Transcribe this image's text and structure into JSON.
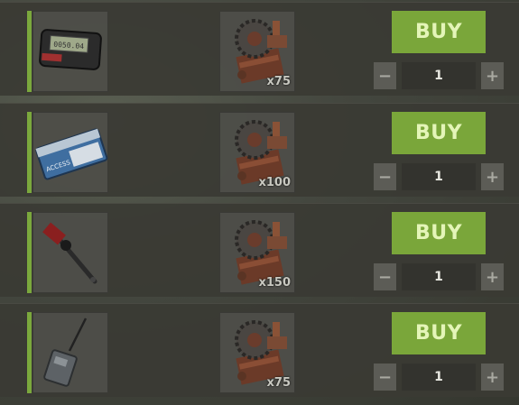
{
  "shop": {
    "offers": [
      {
        "item_icon": "pager-icon",
        "cost_icon": "metal-gears-icon",
        "cost_amount": "x75",
        "buy_label": "BUY",
        "quantity": "1",
        "minus_label": "−",
        "plus_label": "+"
      },
      {
        "item_icon": "keycard-icon",
        "cost_icon": "metal-gears-icon",
        "cost_amount": "x100",
        "buy_label": "BUY",
        "quantity": "1",
        "minus_label": "−",
        "plus_label": "+"
      },
      {
        "item_icon": "torch-wand-icon",
        "cost_icon": "metal-gears-icon",
        "cost_amount": "x150",
        "buy_label": "BUY",
        "quantity": "1",
        "minus_label": "−",
        "plus_label": "+"
      },
      {
        "item_icon": "radio-transmitter-icon",
        "cost_icon": "metal-gears-icon",
        "cost_amount": "x75",
        "buy_label": "BUY",
        "quantity": "1",
        "minus_label": "−",
        "plus_label": "+"
      }
    ]
  },
  "colors": {
    "accent": "#7ba83d",
    "buy_button": "#7aa63a",
    "row_bg": "#3a3a34"
  }
}
